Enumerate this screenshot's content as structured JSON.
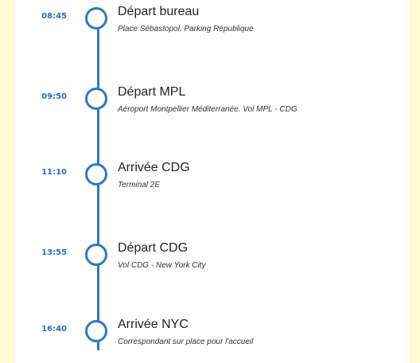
{
  "timeline": {
    "events": [
      {
        "time": "08:45",
        "title": "Départ bureau",
        "subtitle": "Place Sébastopol, Parking République"
      },
      {
        "time": "09:50",
        "title": "Départ MPL",
        "subtitle": "Aéroport Montpellier Méditerranée. Vol MPL - CDG"
      },
      {
        "time": "11:10",
        "title": "Arrivée CDG",
        "subtitle": "Terminal 2E"
      },
      {
        "time": "13:55",
        "title": "Départ CDG",
        "subtitle": "Vol CDG - New York City"
      },
      {
        "time": "16:40",
        "title": "Arrivée NYC",
        "subtitle": "Correspondant sur place pour l'accueil"
      }
    ]
  },
  "colors": {
    "accent": "#2f78c4",
    "time_text": "#2b6fb9",
    "background": "#fffbd3"
  }
}
